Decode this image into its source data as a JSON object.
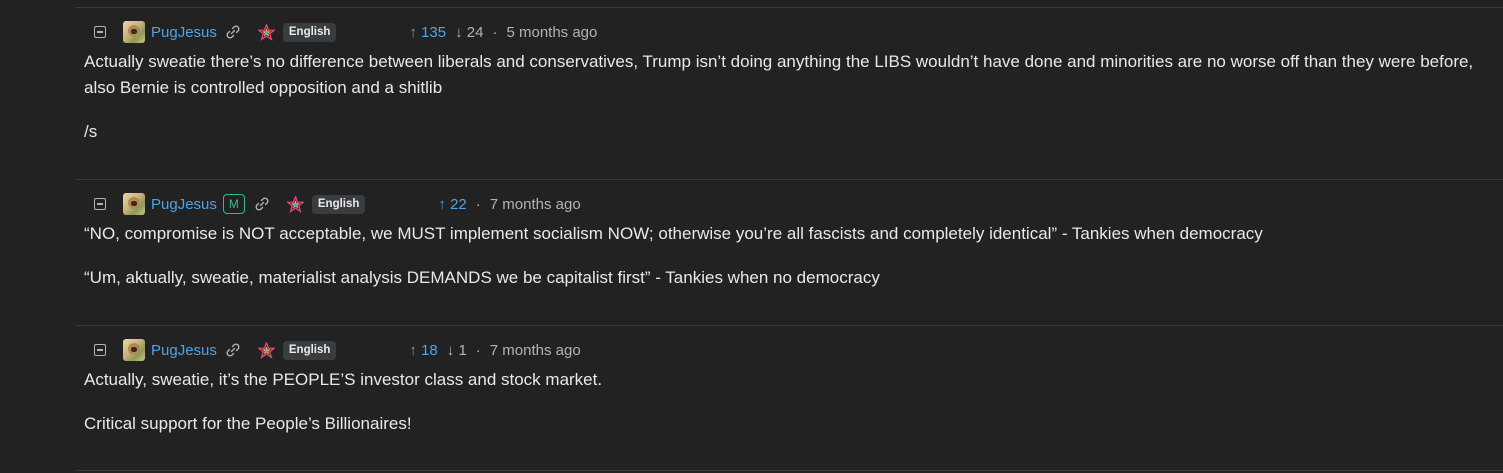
{
  "comments": [
    {
      "username": "PugJesus",
      "is_moderator": false,
      "language": "English",
      "upvotes": "135",
      "downvotes": "24",
      "time": "5 months ago",
      "paragraphs": [
        "Actually sweatie there’s no difference between liberals and conservatives, Trump isn’t doing anything the LIBS wouldn’t have done and minorities are no worse off than they were before, also Bernie is controlled opposition and a shitlib",
        "/s"
      ]
    },
    {
      "username": "PugJesus",
      "is_moderator": true,
      "mod_badge": "M",
      "language": "English",
      "upvotes": "22",
      "time": "7 months ago",
      "paragraphs": [
        "“NO, compromise is NOT acceptable, we MUST implement socialism NOW; otherwise you’re all fascists and completely identical” - Tankies when democracy",
        "“Um, aktually, sweatie, materialist analysis DEMANDS we be capitalist first” - Tankies when no democracy"
      ]
    },
    {
      "username": "PugJesus",
      "is_moderator": false,
      "language": "English",
      "upvotes": "18",
      "downvotes": "1",
      "time": "7 months ago",
      "paragraphs": [
        "Actually, sweatie, it’s the PEOPLE’S investor class and stock market.",
        "Critical support for the People’s Billionaires!"
      ]
    }
  ],
  "icons": {
    "collapse": "collapse-icon",
    "link": "link-icon",
    "instance": "instance-star-icon",
    "upvote": "arrow-up-icon",
    "downvote": "arrow-down-icon"
  },
  "colors": {
    "background": "#222222",
    "link": "#4fa3e3",
    "muted": "#aeb4ba",
    "mod": "#2ebd8a"
  },
  "glyphs": {
    "up": "↑",
    "down": "↓",
    "dot": "·"
  }
}
